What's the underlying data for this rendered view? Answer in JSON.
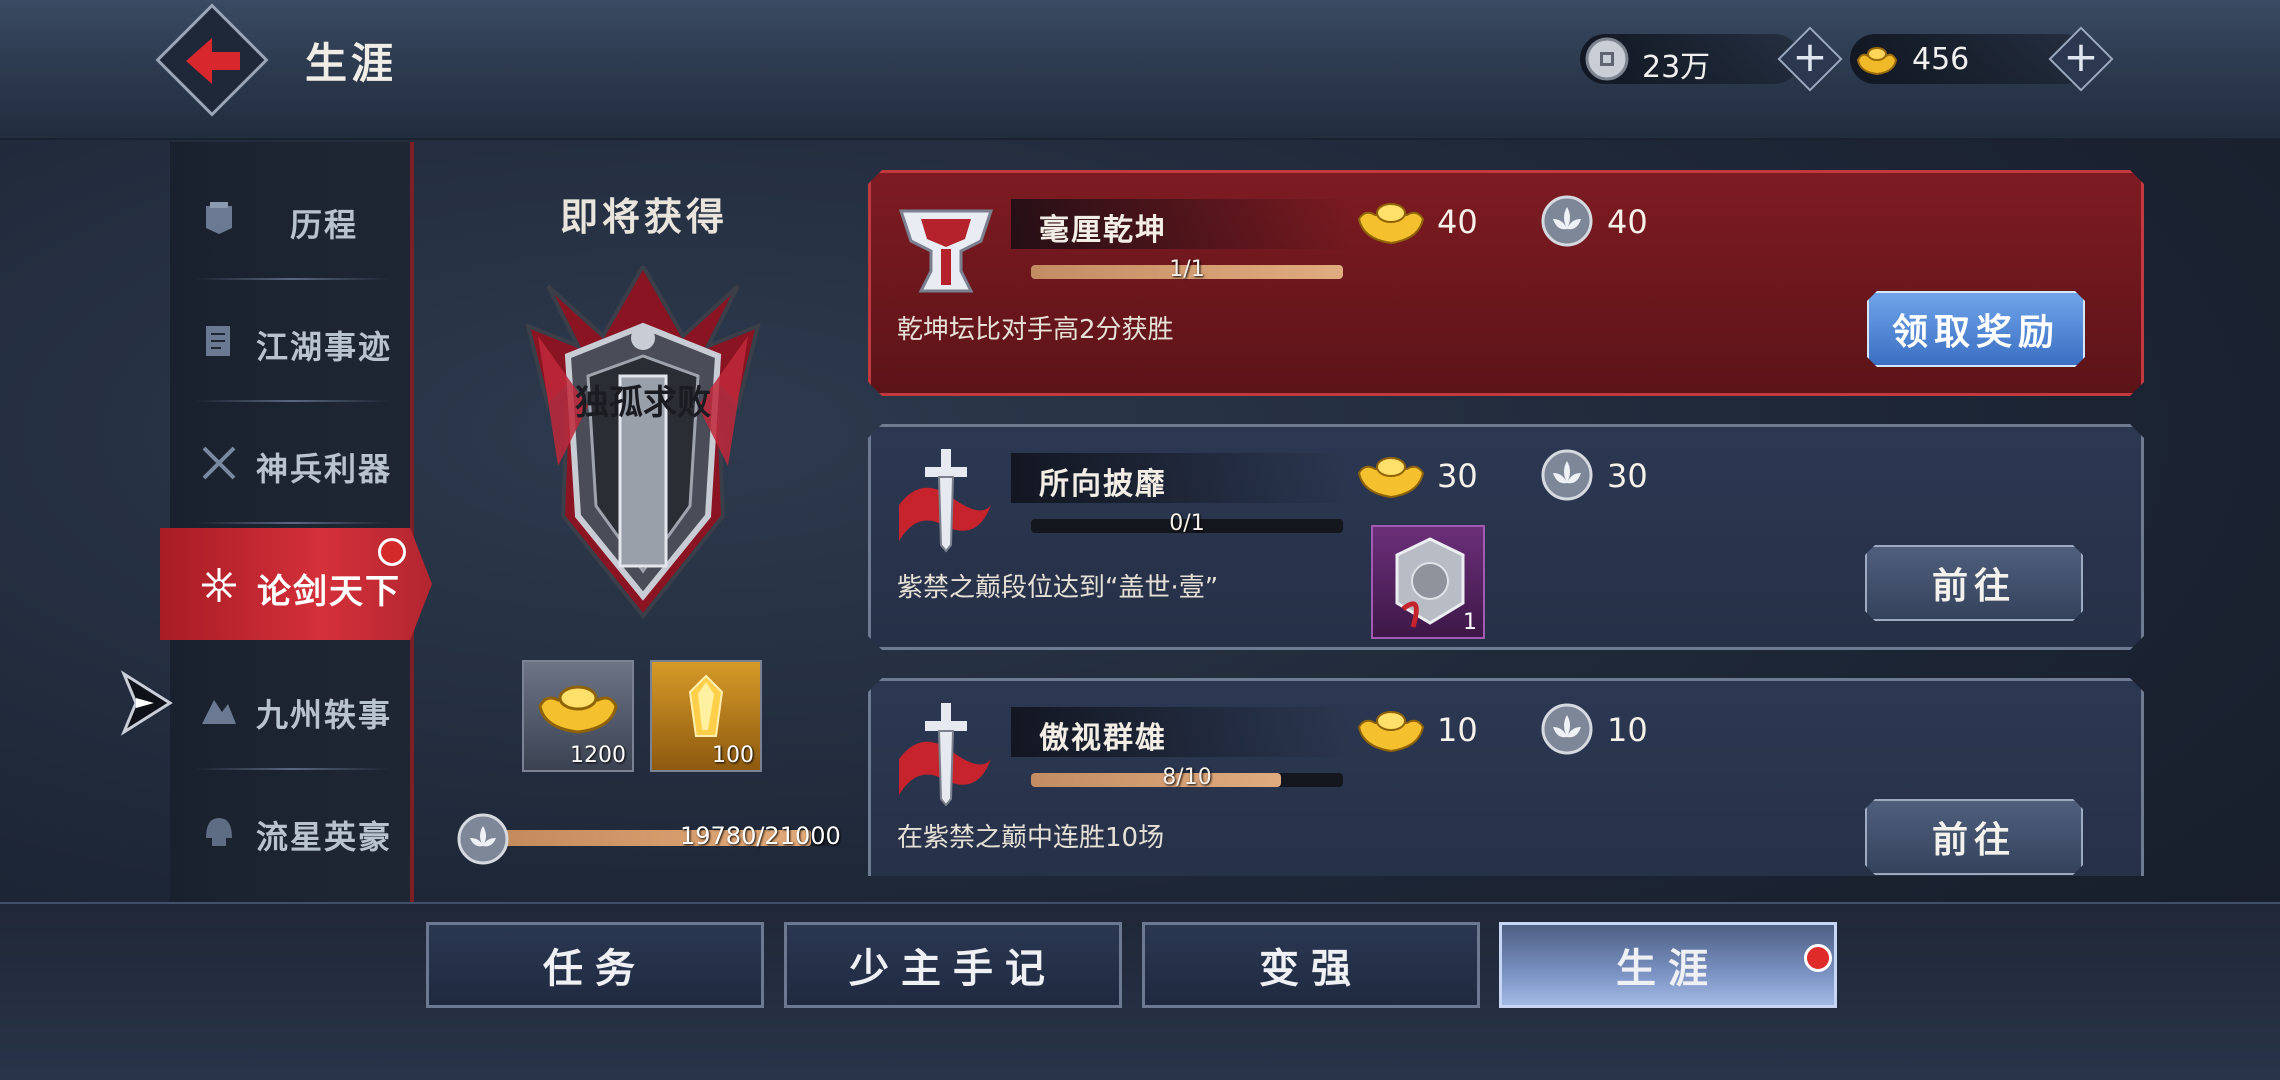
{
  "header": {
    "title": "生涯",
    "silver_value": "23万",
    "gold_value": "456"
  },
  "sidebar": {
    "items": [
      {
        "label": "历程",
        "icon": "banner-icon"
      },
      {
        "label": "江湖事迹",
        "icon": "scroll-icon"
      },
      {
        "label": "神兵利器",
        "icon": "crossed-swords-icon"
      },
      {
        "label": "论剑天下",
        "icon": "sparkle-icon",
        "active": true
      },
      {
        "label": "九州轶事",
        "icon": "mountain-icon"
      },
      {
        "label": "流星英豪",
        "icon": "helmet-icon"
      }
    ]
  },
  "upcoming": {
    "title": "即将获得",
    "badge_text": "独孤求败",
    "rewards": [
      {
        "icon": "gold-ingot-icon",
        "count": "1200"
      },
      {
        "icon": "gold-crystal-icon",
        "count": "100"
      }
    ],
    "progress_text": "19780/21000",
    "progress_fraction": 0.942
  },
  "tasks": [
    {
      "name": "毫厘乾坤",
      "progress_text": "1/1",
      "progress_fraction": 1.0,
      "description": "乾坤坛比对手高2分获胜",
      "gold_reward": "40",
      "point_reward": "40",
      "button": "领取奖励",
      "state": "claimable"
    },
    {
      "name": "所向披靡",
      "progress_text": "0/1",
      "progress_fraction": 0.0,
      "description": "紫禁之巅段位达到“盖世·壹”",
      "gold_reward": "30",
      "point_reward": "30",
      "item_count": "1",
      "button": "前往",
      "state": "in-progress"
    },
    {
      "name": "傲视群雄",
      "progress_text": "8/10",
      "progress_fraction": 0.8,
      "description": "在紫禁之巅中连胜10场",
      "gold_reward": "10",
      "point_reward": "10",
      "button": "前往",
      "state": "in-progress"
    }
  ],
  "bottom_tabs": [
    {
      "label": "任务"
    },
    {
      "label": "少主手记"
    },
    {
      "label": "变强"
    },
    {
      "label": "生涯",
      "active": true
    }
  ],
  "colors": {
    "accent_red": "#c42a33",
    "claim_blue": "#4f86d8",
    "progress_copper": "#d49b6e"
  }
}
